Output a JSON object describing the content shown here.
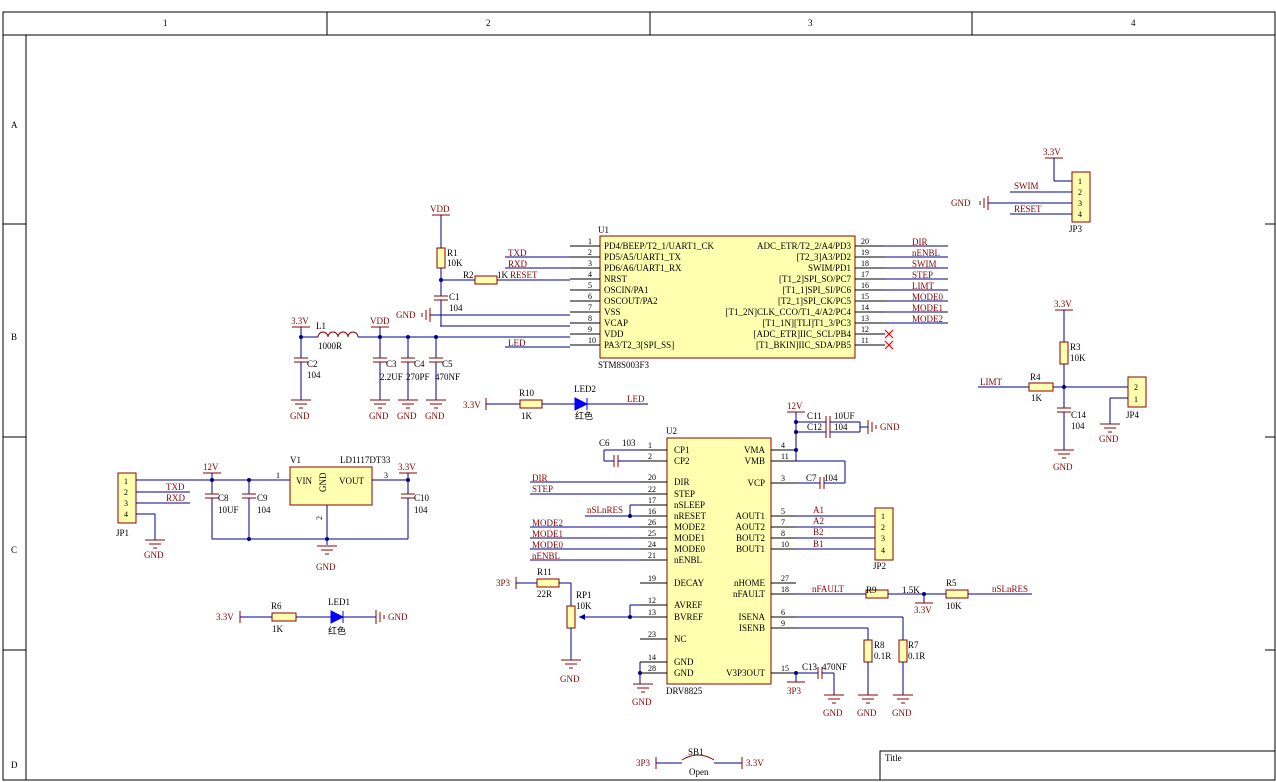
{
  "frame": {
    "columns": [
      "1",
      "2",
      "3",
      "4"
    ],
    "rows": [
      "A",
      "B",
      "C",
      "D"
    ],
    "title_label": "Title"
  },
  "u1": {
    "ref": "U1",
    "part": "STM8S003F3",
    "left_pins": [
      {
        "num": "1",
        "name": "PD4/BEEP/T2_1/UART1_CK"
      },
      {
        "num": "2",
        "name": "PD5/A5/UART1_TX"
      },
      {
        "num": "3",
        "name": "PD6/A6/UART1_RX"
      },
      {
        "num": "4",
        "name": "NRST"
      },
      {
        "num": "5",
        "name": "OSCIN/PA1"
      },
      {
        "num": "6",
        "name": "OSCOUT/PA2"
      },
      {
        "num": "7",
        "name": "VSS"
      },
      {
        "num": "8",
        "name": "VCAP"
      },
      {
        "num": "9",
        "name": "VDD"
      },
      {
        "num": "10",
        "name": "PA3/T2_3[SPI_SS]"
      }
    ],
    "right_pins": [
      {
        "num": "20",
        "name": "ADC_ETR/T2_2/A4/PD3",
        "net": "DIR"
      },
      {
        "num": "19",
        "name": "[T2_3]A3/PD2",
        "net": "nENBL"
      },
      {
        "num": "18",
        "name": "SWIM/PD1",
        "net": "SWIM"
      },
      {
        "num": "17",
        "name": "[T1_2]SPI_SO/PC7",
        "net": "STEP"
      },
      {
        "num": "16",
        "name": "[T1_1]SPI_SI/PC6",
        "net": "LIMT"
      },
      {
        "num": "15",
        "name": "[T2_1]SPI_CK/PC5",
        "net": "MODE0"
      },
      {
        "num": "14",
        "name": "[T1_2N]CLK_CCO/T1_4/A2/PC4",
        "net": "MODE1"
      },
      {
        "num": "13",
        "name": "[T1_1N][TLI]T1_3/PC3",
        "net": "MODE2"
      },
      {
        "num": "12",
        "name": "[ADC_ETR]IIC_SCL/PB4",
        "net": ""
      },
      {
        "num": "11",
        "name": "[T1_BKIN]IIC_SDA/PB5",
        "net": ""
      }
    ],
    "left_nets": {
      "txd": "TXD",
      "rxd": "RXD",
      "reset": "RESET",
      "led": "LED"
    }
  },
  "u2": {
    "ref": "U2",
    "part": "DRV8825",
    "left_pins": [
      {
        "num": "1",
        "name": "CP1"
      },
      {
        "num": "2",
        "name": "CP2"
      },
      {
        "num": "20",
        "name": "DIR"
      },
      {
        "num": "22",
        "name": "STEP"
      },
      {
        "num": "17",
        "name": "nSLEEP"
      },
      {
        "num": "16",
        "name": "nRESET"
      },
      {
        "num": "26",
        "name": "MODE2"
      },
      {
        "num": "25",
        "name": "MODE1"
      },
      {
        "num": "24",
        "name": "MODE0"
      },
      {
        "num": "21",
        "name": "nENBL"
      },
      {
        "num": "19",
        "name": "DECAY"
      },
      {
        "num": "12",
        "name": "AVREF"
      },
      {
        "num": "13",
        "name": "BVREF"
      },
      {
        "num": "23",
        "name": "NC"
      },
      {
        "num": "14",
        "name": "GND"
      },
      {
        "num": "28",
        "name": "GND"
      }
    ],
    "right_pins": [
      {
        "num": "4",
        "name": "VMA"
      },
      {
        "num": "11",
        "name": "VMB"
      },
      {
        "num": "3",
        "name": "VCP"
      },
      {
        "num": "5",
        "name": "AOUT1",
        "net": "A1"
      },
      {
        "num": "7",
        "name": "AOUT2",
        "net": "A2"
      },
      {
        "num": "8",
        "name": "BOUT2",
        "net": "B2"
      },
      {
        "num": "10",
        "name": "BOUT1",
        "net": "B1"
      },
      {
        "num": "27",
        "name": "nHOME"
      },
      {
        "num": "18",
        "name": "nFAULT",
        "net": "nFAULT"
      },
      {
        "num": "6",
        "name": "ISENA"
      },
      {
        "num": "9",
        "name": "ISENB"
      },
      {
        "num": "15",
        "name": "V3P3OUT"
      }
    ],
    "left_nets": [
      "DIR",
      "STEP",
      "nSLnRES",
      "MODE2",
      "MODE1",
      "MODE0",
      "nENBL"
    ]
  },
  "v1": {
    "ref": "V1",
    "part": "LD1117DT33",
    "vin": "VIN",
    "vout": "VOUT",
    "gnd": "GND",
    "pin1": "1",
    "pin2": "2",
    "pin3": "3"
  },
  "components": {
    "r1": {
      "ref": "R1",
      "val": "10K"
    },
    "r2": {
      "ref": "R2",
      "val": "1K"
    },
    "r3": {
      "ref": "R3",
      "val": "10K"
    },
    "r4": {
      "ref": "R4",
      "val": "1K"
    },
    "r5": {
      "ref": "R5",
      "val": "10K"
    },
    "r6": {
      "ref": "R6",
      "val": "1K"
    },
    "r7": {
      "ref": "R7",
      "val": "0.1R"
    },
    "r8": {
      "ref": "R8",
      "val": "0.1R"
    },
    "r9": {
      "ref": "R9",
      "val": "1.5K"
    },
    "r10": {
      "ref": "R10",
      "val": "1K"
    },
    "r11": {
      "ref": "R11",
      "val": "22R"
    },
    "rp1": {
      "ref": "RP1",
      "val": "10K"
    },
    "l1": {
      "ref": "L1",
      "val": "1000R"
    },
    "c1": {
      "ref": "C1",
      "val": "104"
    },
    "c2": {
      "ref": "C2",
      "val": "104"
    },
    "c3": {
      "ref": "C3",
      "val": "2.2UF"
    },
    "c4": {
      "ref": "C4",
      "val": "270PF"
    },
    "c5": {
      "ref": "C5",
      "val": "470NF"
    },
    "c6": {
      "ref": "C6",
      "val": "103"
    },
    "c7": {
      "ref": "C7",
      "val": "104"
    },
    "c8": {
      "ref": "C8",
      "val": "10UF"
    },
    "c9": {
      "ref": "C9",
      "val": "104"
    },
    "c10": {
      "ref": "C10",
      "val": "104"
    },
    "c11": {
      "ref": "C11",
      "val": "10UF"
    },
    "c12": {
      "ref": "C12",
      "val": "104"
    },
    "c13": {
      "ref": "C13",
      "val": "470NF"
    },
    "c14": {
      "ref": "C14",
      "val": "104"
    },
    "led1": {
      "ref": "LED1",
      "val": "红色"
    },
    "led2": {
      "ref": "LED2",
      "val": "红色"
    },
    "sb1": {
      "ref": "SB1",
      "val": "Open"
    }
  },
  "connectors": {
    "jp1": {
      "ref": "JP1",
      "pins": [
        "1",
        "2",
        "3",
        "4"
      ],
      "nets": [
        "TXD",
        "RXD"
      ]
    },
    "jp2": {
      "ref": "JP2",
      "pins": [
        "1",
        "2",
        "3",
        "4"
      ]
    },
    "jp3": {
      "ref": "JP3",
      "pins": [
        "1",
        "2",
        "3",
        "4"
      ],
      "nets": [
        "SWIM",
        "RESET"
      ]
    },
    "jp4": {
      "ref": "JP4",
      "pins": [
        "2",
        "1"
      ]
    }
  },
  "power": {
    "vdd": "VDD",
    "v33": "3.3V",
    "v12": "12V",
    "gnd": "GND",
    "p3p3": "3P3"
  },
  "nets": {
    "limt": "LIMT",
    "nslnres": "nSLnRES",
    "nfault": "nFAULT",
    "led": "LED"
  },
  "colors": {
    "wire": "#00008b",
    "part_border": "#8b0000",
    "part_fill": "#ffffb0",
    "net_label": "#8b0000",
    "no_connect": "#ff0000"
  }
}
